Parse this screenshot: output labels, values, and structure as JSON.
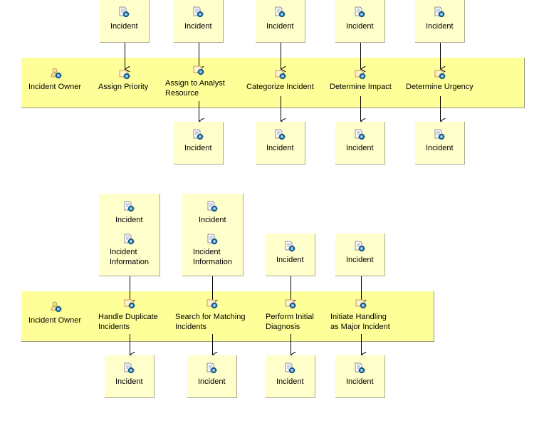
{
  "diagram": {
    "lanes": [
      {
        "role": "Incident Owner",
        "tasks": [
          {
            "label": "Assign Priority",
            "inputs": [
              "Incident"
            ],
            "outputs": []
          },
          {
            "label": "Assign to Analyst Resource",
            "label_lines": [
              "Assign to Analyst",
              "Resource"
            ],
            "inputs": [
              "Incident"
            ],
            "outputs": [
              "Incident"
            ]
          },
          {
            "label": "Categorize Incident",
            "inputs": [
              "Incident"
            ],
            "outputs": [
              "Incident"
            ]
          },
          {
            "label": "Determine Impact",
            "inputs": [
              "Incident"
            ],
            "outputs": [
              "Incident"
            ]
          },
          {
            "label": "Determine Urgency",
            "inputs": [
              "Incident"
            ],
            "outputs": [
              "Incident"
            ]
          }
        ]
      },
      {
        "role": "Incident Owner",
        "tasks": [
          {
            "label": "Handle Duplicate Incidents",
            "label_lines": [
              "Handle Duplicate",
              "Incidents"
            ],
            "inputs": [
              "Incident",
              "Incident Information"
            ],
            "outputs": [
              "Incident"
            ]
          },
          {
            "label": "Search for Matching Incidents",
            "label_lines": [
              "Search for Matching",
              "Incidents"
            ],
            "inputs": [
              "Incident",
              "Incident Information"
            ],
            "outputs": [
              "Incident"
            ]
          },
          {
            "label": "Perform Initial Diagnosis",
            "label_lines": [
              "Perform Initial",
              "Diagnosis"
            ],
            "inputs": [
              "Incident"
            ],
            "outputs": [
              "Incident"
            ]
          },
          {
            "label": "Initiate Handling as Major Incident",
            "label_lines": [
              "Initiate Handling",
              "as Major Incident"
            ],
            "inputs": [
              "Incident"
            ],
            "outputs": [
              "Incident"
            ]
          }
        ]
      }
    ],
    "text": {
      "l1_role": "Incident Owner",
      "l1_t1": "Assign Priority",
      "l1_t2a": "Assign to Analyst",
      "l1_t2b": "Resource",
      "l1_t3": "Categorize Incident",
      "l1_t4": "Determine Impact",
      "l1_t5": "Determine Urgency",
      "l2_role": "Incident Owner",
      "l2_t1a": "Handle Duplicate",
      "l2_t1b": "Incidents",
      "l2_t2a": "Search for Matching",
      "l2_t2b": "Incidents",
      "l2_t3a": "Perform Initial",
      "l2_t3b": "Diagnosis",
      "l2_t4a": "Initiate Handling",
      "l2_t4b": "as Major Incident",
      "incident": "Incident",
      "incident_info_a": "Incident",
      "incident_info_b": "Information"
    },
    "icons": {
      "role": "role-user-icon",
      "task": "task-icon",
      "artifact": "document-artifact-icon"
    },
    "colors": {
      "lane_fill": "#ffff99",
      "artifact_fill": "#ffffcc",
      "edge": "#000000"
    }
  }
}
